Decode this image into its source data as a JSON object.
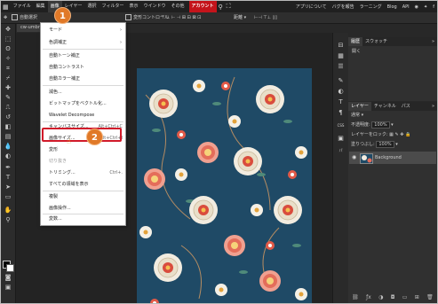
{
  "menubar": {
    "items": [
      "ファイル",
      "編集",
      "画像",
      "レイヤー",
      "選択",
      "フィルター",
      "表示",
      "ウインドウ",
      "その他",
      "アカウント"
    ],
    "right_items": [
      "アプリについて",
      "バグを報告",
      "ラーニング",
      "Blog",
      "API"
    ]
  },
  "options": {
    "auto_select": "自動選択",
    "transform": "変形コントロール",
    "distance": "距離"
  },
  "document": {
    "tab_name": "cw-umbrel"
  },
  "image_menu": {
    "items": [
      {
        "label": "モード",
        "submenu": true
      },
      {
        "label": "色調補正",
        "submenu": true
      },
      {
        "label": "自動トーン補正"
      },
      {
        "label": "自動コントラスト"
      },
      {
        "label": "自動カラー補正"
      },
      {
        "label": "減色..."
      },
      {
        "label": "ビットマップをベクトル化..."
      },
      {
        "label": "Wavelet Decompose"
      },
      {
        "label": "キャンバスサイズ...",
        "shortcut": "Alt+Ctrl+C"
      },
      {
        "label": "画像サイズ...",
        "shortcut": "Alt+Ctrl+I"
      },
      {
        "label": "変形"
      },
      {
        "label": "切り抜き",
        "disabled": true
      },
      {
        "label": "トリミング...",
        "shortcut": "Ctrl+."
      },
      {
        "label": "すべての領域を表示"
      },
      {
        "label": "複製"
      },
      {
        "label": "画像操作..."
      },
      {
        "label": "変数..."
      }
    ]
  },
  "callouts": [
    "1",
    "2"
  ],
  "panels": {
    "top_tabs": [
      "履歴",
      "スウォッチ"
    ],
    "history_item": "開く",
    "layer_tabs": [
      "レイヤー",
      "チャンネル",
      "パス"
    ],
    "blend_mode": "通常",
    "opacity_label": "不透明度:",
    "opacity_value": "100%",
    "lock_label": "レイヤーをロック:",
    "fill_label": "塗りつぶし:",
    "fill_value": "100%",
    "layer_name": "Background"
  },
  "icon_strip": [
    "CSS",
    "パ"
  ],
  "colors": {
    "accent": "#c4141b",
    "callout": "#e07928",
    "canvas": "#1f4a66"
  }
}
